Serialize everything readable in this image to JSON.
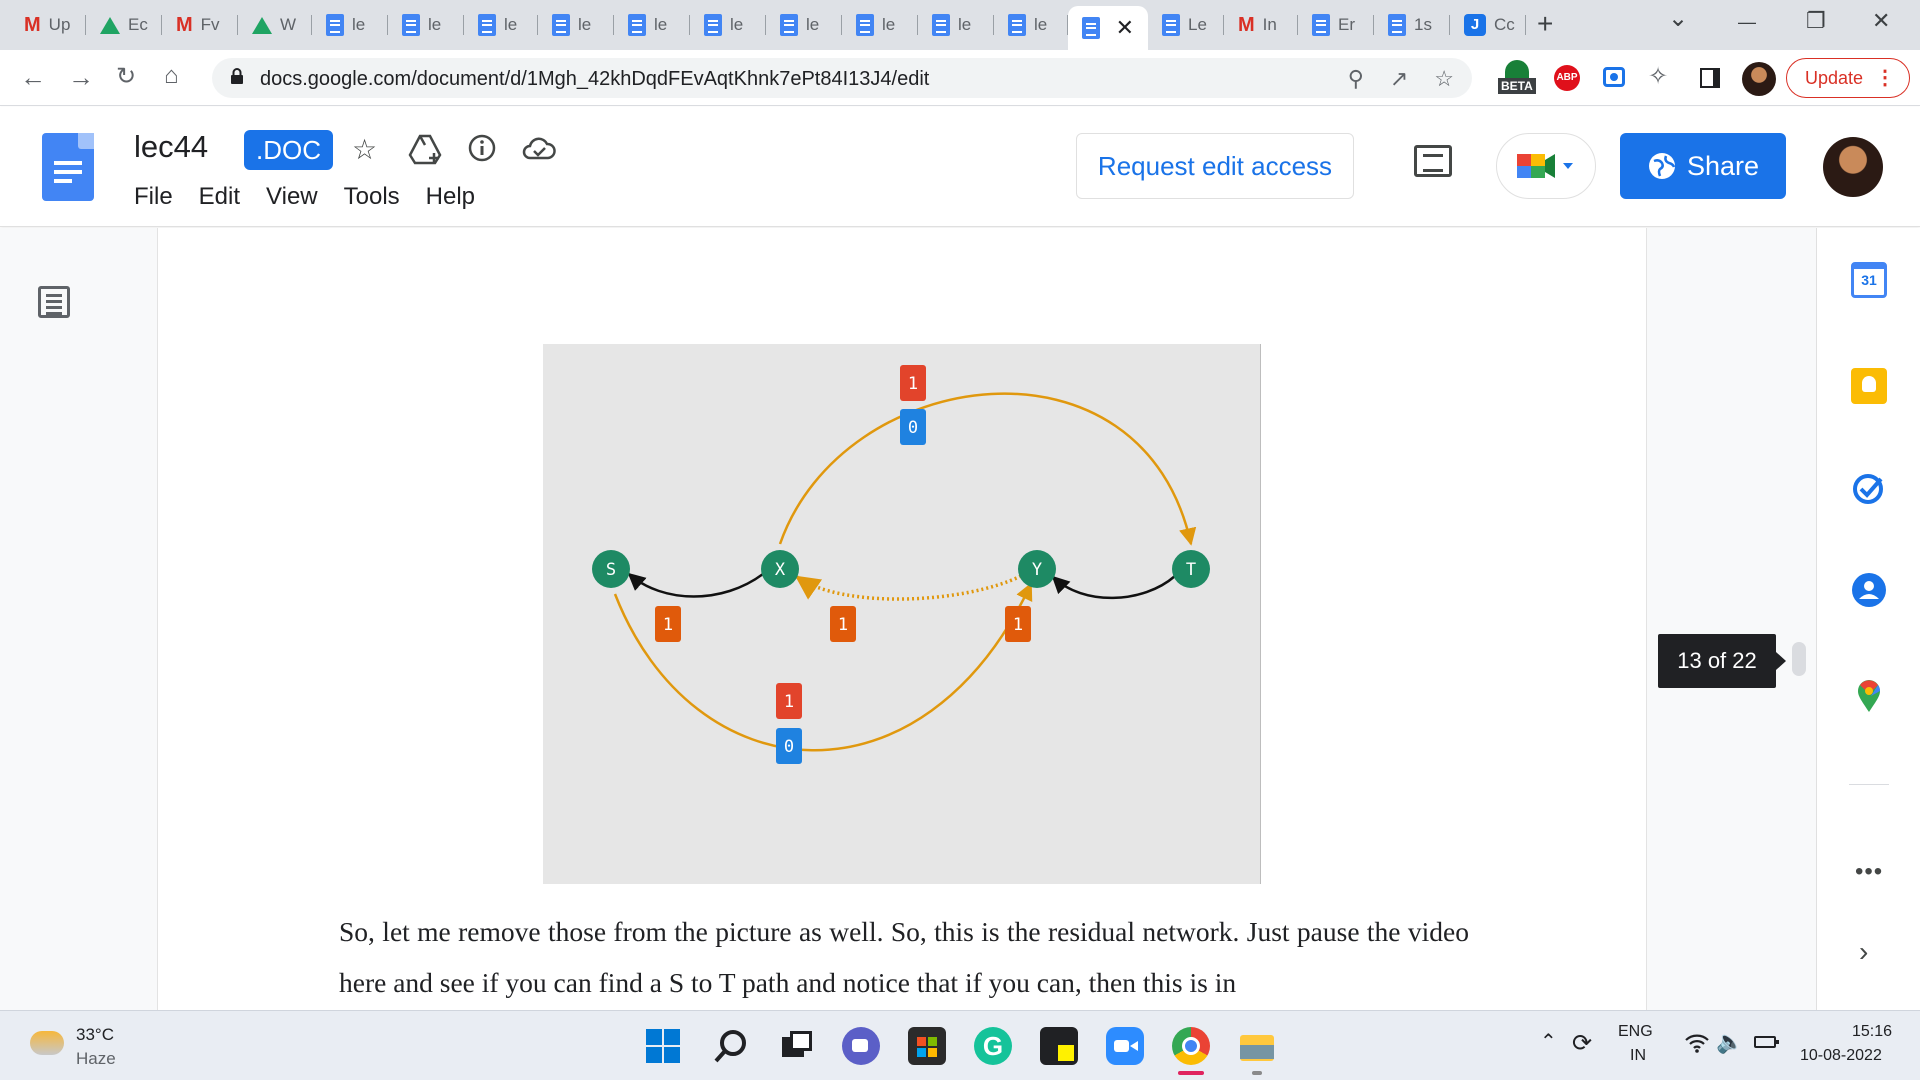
{
  "browser": {
    "tabs": [
      {
        "icon": "gmail-icon",
        "title": "Up"
      },
      {
        "icon": "drive-icon",
        "title": "Ec"
      },
      {
        "icon": "gmail-icon",
        "title": "Fv"
      },
      {
        "icon": "drive-icon",
        "title": "W"
      },
      {
        "icon": "docs-icon",
        "title": "le"
      },
      {
        "icon": "docs-icon",
        "title": "le"
      },
      {
        "icon": "docs-icon",
        "title": "le"
      },
      {
        "icon": "docs-icon",
        "title": "le"
      },
      {
        "icon": "docs-icon",
        "title": "le"
      },
      {
        "icon": "docs-icon",
        "title": "le"
      },
      {
        "icon": "docs-icon",
        "title": "le"
      },
      {
        "icon": "docs-icon",
        "title": "le"
      },
      {
        "icon": "docs-icon",
        "title": "le"
      },
      {
        "icon": "docs-icon",
        "title": "le"
      },
      {
        "icon": "docs-icon",
        "title": "",
        "active": true
      },
      {
        "icon": "docs-icon",
        "title": "Le"
      },
      {
        "icon": "gmail-icon",
        "title": "In"
      },
      {
        "icon": "docs-icon",
        "title": "Er"
      },
      {
        "icon": "docs-icon",
        "title": "1s"
      },
      {
        "icon": "j-icon",
        "title": "Cc"
      }
    ],
    "url": "docs.google.com/document/d/1Mgh_42khDqdFEvAqtKhnk7ePt84I13J4/edit",
    "update_label": "Update",
    "beta_label": "BETA",
    "abp_label": "ABP"
  },
  "doc": {
    "title": "lec44",
    "badge": ".DOC",
    "menu": [
      "File",
      "Edit",
      "View",
      "Tools",
      "Help"
    ],
    "request_edit": "Request edit access",
    "share": "Share",
    "page_count": "13 of 22",
    "paragraph": "So, let me remove those from the picture as well. So, this is the residual network. Just pause the video here and see if you can find a S to T path and notice that if you can, then this is in"
  },
  "diagram": {
    "nodes": [
      {
        "id": "S",
        "label": "S"
      },
      {
        "id": "X",
        "label": "X"
      },
      {
        "id": "Y",
        "label": "Y"
      },
      {
        "id": "T",
        "label": "T"
      }
    ],
    "edge_labels": {
      "top_arc_red": "1",
      "top_arc_blue": "0",
      "xs_label": "1",
      "yx_label": "1",
      "ty_label": "1",
      "bottom_arc_red": "1",
      "bottom_arc_blue": "0"
    },
    "colors": {
      "node": "#1e8a64",
      "orange_edge": "#e0980e",
      "black_edge": "#111111",
      "red_label": "#e2442b",
      "orange_label": "#e05a0b",
      "blue_label": "#1f82e0",
      "background": "#e6e6e6"
    }
  },
  "side_panel": {
    "calendar_label": "31"
  },
  "taskbar": {
    "temperature": "33°C",
    "weather": "Haze",
    "lang_top": "ENG",
    "lang_bottom": "IN",
    "time": "15:16",
    "date": "10-08-2022"
  }
}
